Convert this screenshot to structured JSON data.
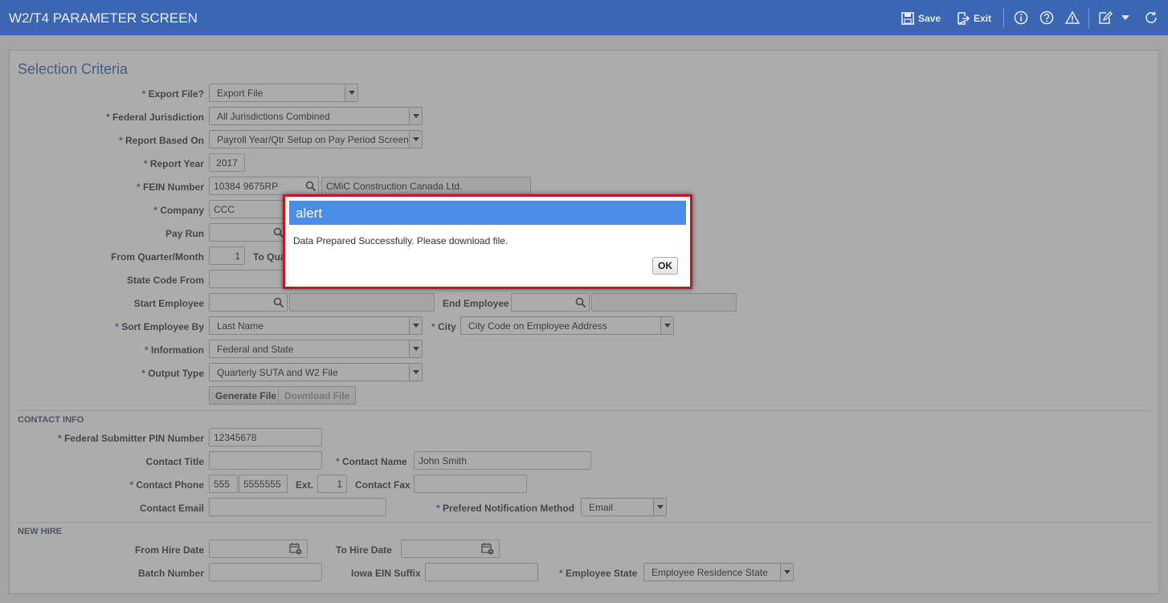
{
  "header": {
    "title": "W2/T4 PARAMETER SCREEN",
    "save_label": "Save",
    "exit_label": "Exit"
  },
  "selection": {
    "title": "Selection Criteria",
    "export_file_label": "Export File?",
    "export_file_value": "Export File",
    "federal_jurisdiction_label": "Federal Jurisdiction",
    "federal_jurisdiction_value": "All Jurisdictions Combined",
    "report_based_on_label": "Report Based On",
    "report_based_on_value": "Payroll Year/Qtr Setup on Pay Period Screen",
    "report_year_label": "Report Year",
    "report_year_value": "2017",
    "fein_label": "FEIN Number",
    "fein_value": "10384 9675RP",
    "fein_name": "CMiC Construction Canada Ltd.",
    "company_label": "Company",
    "company_value": "CCC",
    "pay_run_label": "Pay Run",
    "from_quarter_label": "From Quarter/Month",
    "from_quarter_value": "1",
    "to_quarter_label": "To Quar",
    "state_code_label": "State Code From",
    "start_employee_label": "Start Employee",
    "end_employee_label": "End Employee",
    "sort_label": "Sort Employee By",
    "sort_value": "Last Name",
    "city_label": "City",
    "city_value": "City Code on Employee Address",
    "information_label": "Information",
    "information_value": "Federal and State",
    "output_type_label": "Output Type",
    "output_type_value": "Quarterly SUTA and W2 File",
    "generate_label": "Generate File",
    "download_label": "Download File"
  },
  "contact": {
    "header": "CONTACT INFO",
    "pin_label": "Federal Submitter PIN Number",
    "pin_value": "12345678",
    "title_label": "Contact Title",
    "name_label": "Contact Name",
    "name_value": "John Smith",
    "phone_label": "Contact Phone",
    "phone_area": "555",
    "phone_number": "5555555",
    "ext_label": "Ext.",
    "ext_value": "1",
    "fax_label": "Contact Fax",
    "email_label": "Contact Email",
    "notify_label": "Prefered Notification Method",
    "notify_value": "Email"
  },
  "newhire": {
    "header": "NEW HIRE",
    "from_label": "From Hire Date",
    "to_label": "To Hire Date",
    "batch_label": "Batch Number",
    "iowa_label": "Iowa EIN Suffix",
    "state_label": "Employee State",
    "state_value": "Employee Residence State"
  },
  "alert": {
    "title": "alert",
    "message": "Data Prepared Successfully. Please download file.",
    "ok_label": "OK"
  },
  "required_mark": "*",
  "colors": {
    "header_bg": "#3a66b4",
    "accent": "#2a62b8",
    "alert_border": "#c8141e",
    "alert_header": "#4a8de6"
  }
}
